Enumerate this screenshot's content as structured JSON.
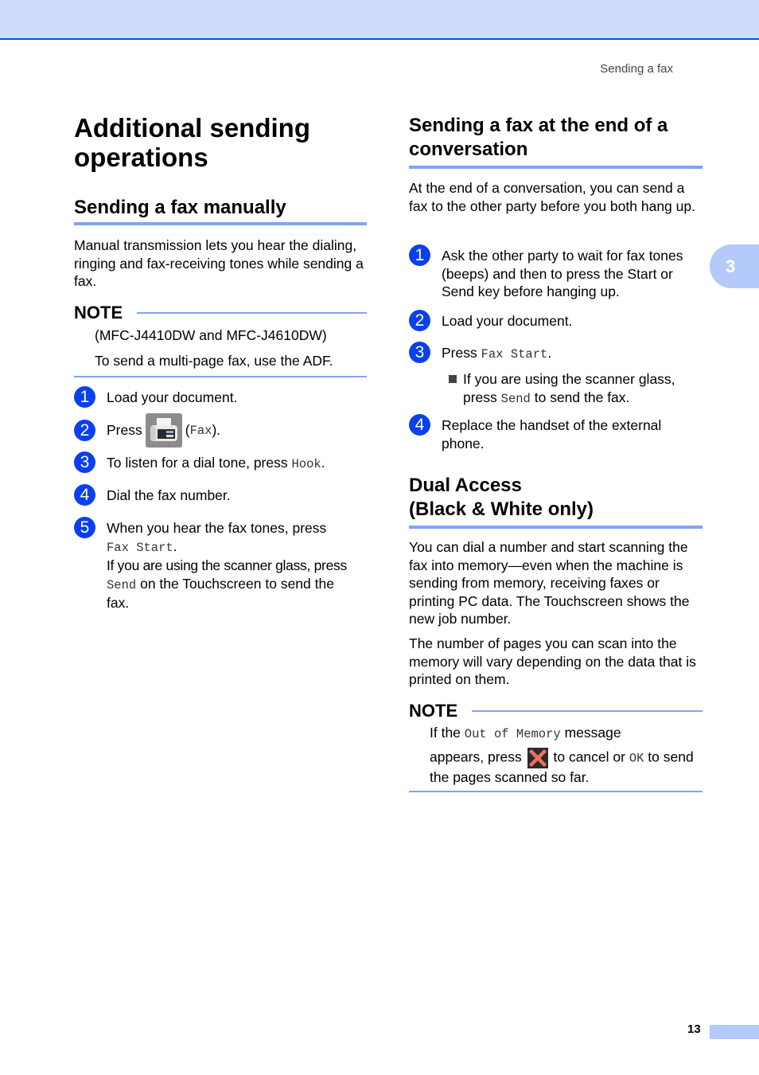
{
  "header": {
    "running_head": "Sending a fax"
  },
  "chapter_tab": {
    "number": "3"
  },
  "left": {
    "title_line1": "Additional sending",
    "title_line2": "operations",
    "section_title": "Sending a fax manually",
    "intro": "Manual transmission lets you hear the dialing, ringing and fax-receiving tones while sending a fax.",
    "note": {
      "title": "NOTE",
      "line1": "(MFC-J4410DW and MFC-J4610DW)",
      "line2": "To send a multi-page fax, use the ADF."
    },
    "steps": [
      {
        "num": "1",
        "text": "Load your document."
      },
      {
        "num": "2",
        "pre": "Press",
        "icon": "fax-icon",
        "code": "Fax",
        "open": "(",
        "close": ")."
      },
      {
        "num": "3",
        "pre": "To listen for a dial tone, press ",
        "code": "Hook",
        "post": "."
      },
      {
        "num": "4",
        "text": "Dial the fax number."
      },
      {
        "num": "5",
        "line1": "When you hear the fax tones, press",
        "code1": "Fax Start",
        "post1": ".",
        "line2": "If you are using the scanner glass, press",
        "code2": "Send",
        "post2": " on the Touchscreen to send the",
        "line3": "fax."
      }
    ]
  },
  "right": {
    "section1_title_line1": "Sending a fax at the end of a",
    "section1_title_line2": "conversation",
    "section1_intro": "At the end of a conversation, you can send a fax to the other party before you both hang up.",
    "steps": [
      {
        "num": "1",
        "text": "Ask the other party to wait for fax tones (beeps) and then to press the Start or Send key before hanging up."
      },
      {
        "num": "2",
        "text": "Load your document."
      },
      {
        "num": "3",
        "pre": "Press ",
        "code": "Fax Start",
        "post": ".",
        "sub_pre": "If you are using the scanner glass,",
        "sub_pre2": "press ",
        "sub_code": "Send",
        "sub_post": " to send the fax."
      },
      {
        "num": "4",
        "text": "Replace the handset of the external phone."
      }
    ],
    "section2_title_line1": "Dual Access",
    "section2_title_line2": "(Black & White only)",
    "section2_p1": "You can dial a number and start scanning the fax into memory—even when the machine is sending from memory, receiving faxes or printing PC data. The Touchscreen shows the new job number.",
    "section2_p2": "The number of pages you can scan into the memory will vary depending on the data that is printed on them.",
    "note": {
      "title": "NOTE",
      "pre": "If the ",
      "code1": "Out of Memory",
      "post1": " message",
      "line2_pre": "appears, press ",
      "icon": "cancel-x-icon",
      "line2_mid": " to cancel or ",
      "code2": "OK",
      "line2_post": " to send",
      "line3": "the pages scanned so far."
    }
  },
  "footer": {
    "page_number": "13"
  }
}
